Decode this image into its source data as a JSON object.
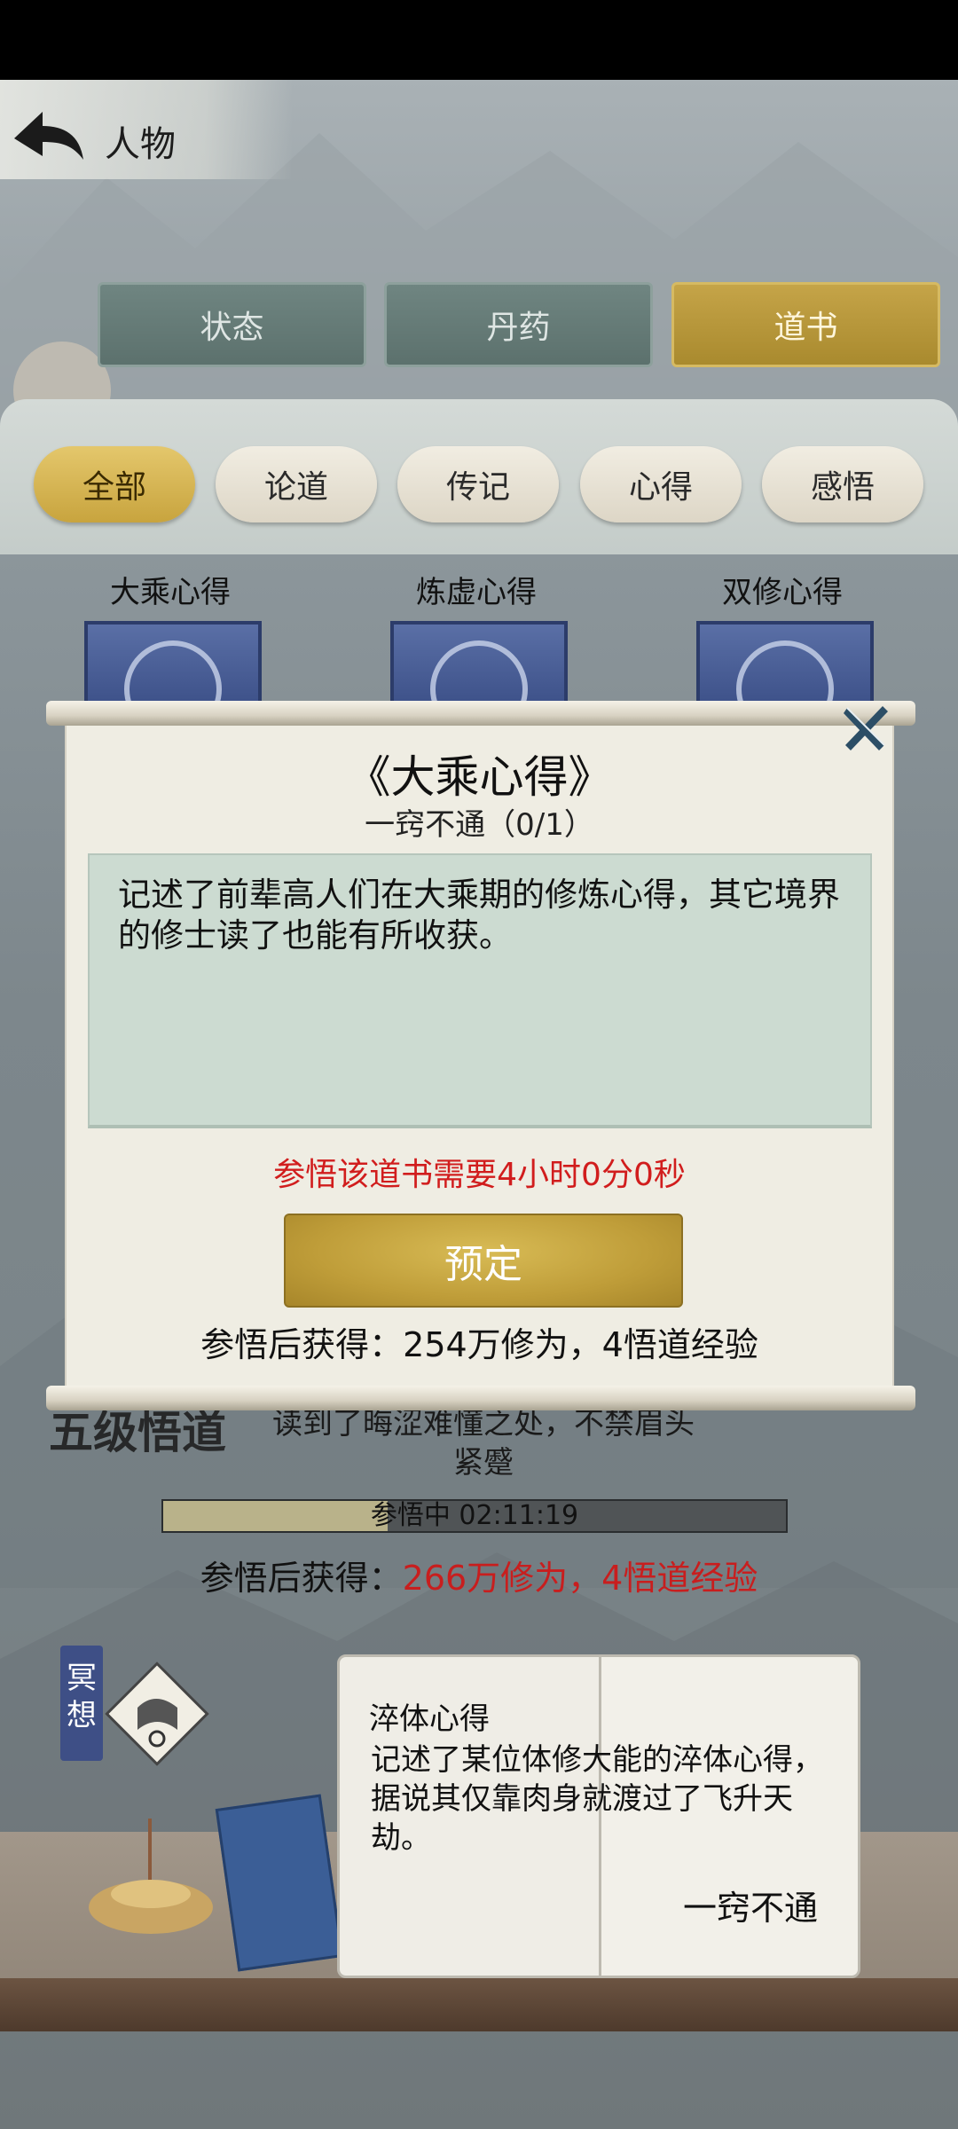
{
  "header": {
    "title": "人物",
    "back_icon": "back-arrow-icon"
  },
  "main_tabs": [
    {
      "label": "状态",
      "active": false
    },
    {
      "label": "丹药",
      "active": false
    },
    {
      "label": "道书",
      "active": true
    }
  ],
  "filter_tabs": [
    {
      "label": "全部",
      "active": true
    },
    {
      "label": "论道",
      "active": false
    },
    {
      "label": "传记",
      "active": false
    },
    {
      "label": "心得",
      "active": false
    },
    {
      "label": "感悟",
      "active": false
    }
  ],
  "books": [
    {
      "title": "大乘心得"
    },
    {
      "title": "炼虚心得"
    },
    {
      "title": "双修心得"
    }
  ],
  "modal": {
    "title": "《大乘心得》",
    "subtitle": "一窍不通（0/1）",
    "description": "记述了前辈高人们在大乘期的修炼心得，其它境界的修士读了也能有所收获。",
    "time_required": "参悟该道书需要4小时0分0秒",
    "reserve_button": "预定",
    "reward": "参悟后获得：254万修为，4悟道经验",
    "close_icon": "close-icon"
  },
  "study": {
    "level": "五级悟道",
    "flavor": "读到了晦涩难懂之处，不禁眉头紧蹙",
    "progress_label": "参悟中 02:11:19",
    "reward_prefix": "参悟后获得：",
    "reward_value": "266万修为，4悟道经验"
  },
  "open_book": {
    "heading": "淬体心得",
    "description": "记述了某位体修大能的淬体心得，据说其仅靠肉身就渡过了飞升天劫。",
    "status": "一窍不通"
  },
  "meditate": {
    "label": "冥想"
  },
  "colors": {
    "accent_gold": "#c5a448",
    "inactive_tab": "#5c716d",
    "warning_red": "#d11d1d"
  }
}
